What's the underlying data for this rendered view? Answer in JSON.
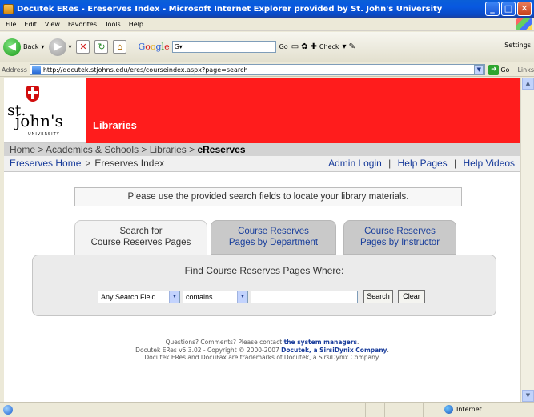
{
  "window": {
    "title": "Docutek ERes - Ereserves Index - Microsoft Internet Explorer provided by St. John's University",
    "min_btn": "_",
    "max_btn": "□",
    "close_btn": "✕"
  },
  "menu": {
    "items": [
      "File",
      "Edit",
      "View",
      "Favorites",
      "Tools",
      "Help"
    ]
  },
  "toolbar": {
    "back_label": "Back",
    "google_letters": [
      "G",
      "o",
      "o",
      "g",
      "l",
      "e"
    ],
    "google_box": "G▾",
    "go_label": "Go",
    "check_label": "Check",
    "settings_label": "Settings"
  },
  "address": {
    "label": "Address",
    "url": "http://docutek.stjohns.edu/eres/courseindex.aspx?page=search",
    "go_label": "Go",
    "links_label": "Links"
  },
  "site": {
    "logo_st": "st.",
    "logo_johns": "john's",
    "logo_university": "UNIVERSITY",
    "libraries_label": "Libraries"
  },
  "breadcrumb": {
    "path": "Home > Academics & Schools > Libraries > ",
    "current": "eReserves"
  },
  "subnav": {
    "left_home": "Ereserves Home",
    "left_sep": ">",
    "left_current": "Ereserves Index",
    "admin_login": "Admin Login",
    "help_pages": "Help Pages",
    "help_videos": "Help Videos",
    "sep": "|"
  },
  "notice": "Please use the provided search fields to locate your library materials.",
  "tabs": [
    {
      "line1": "Search for",
      "line2": "Course Reserves Pages",
      "active": true
    },
    {
      "line1": "Course Reserves",
      "line2": "Pages by Department",
      "active": false
    },
    {
      "line1": "Course Reserves",
      "line2": "Pages by Instructor",
      "active": false
    }
  ],
  "search": {
    "heading": "Find Course Reserves Pages Where:",
    "field_select": "Any Search Field",
    "operator_select": "contains",
    "query_value": "",
    "search_button": "Search",
    "clear_button": "Clear"
  },
  "footer": {
    "line1_prefix": "Questions? Comments? Please contact ",
    "line1_link": "the system managers",
    "line1_suffix": ".",
    "line2_prefix": "Docutek ERes v5.3.02 - Copyright © 2000-2007 ",
    "line2_link": "Docutek, a SirsiDynix Company",
    "line2_suffix": ".",
    "line3": "Docutek ERes and DocuFax are trademarks of Docutek, a SirsiDynix Company."
  },
  "status": {
    "zone": "Internet"
  },
  "colors": {
    "brand_red": "#ff1c1c",
    "link_blue": "#163a9a"
  }
}
